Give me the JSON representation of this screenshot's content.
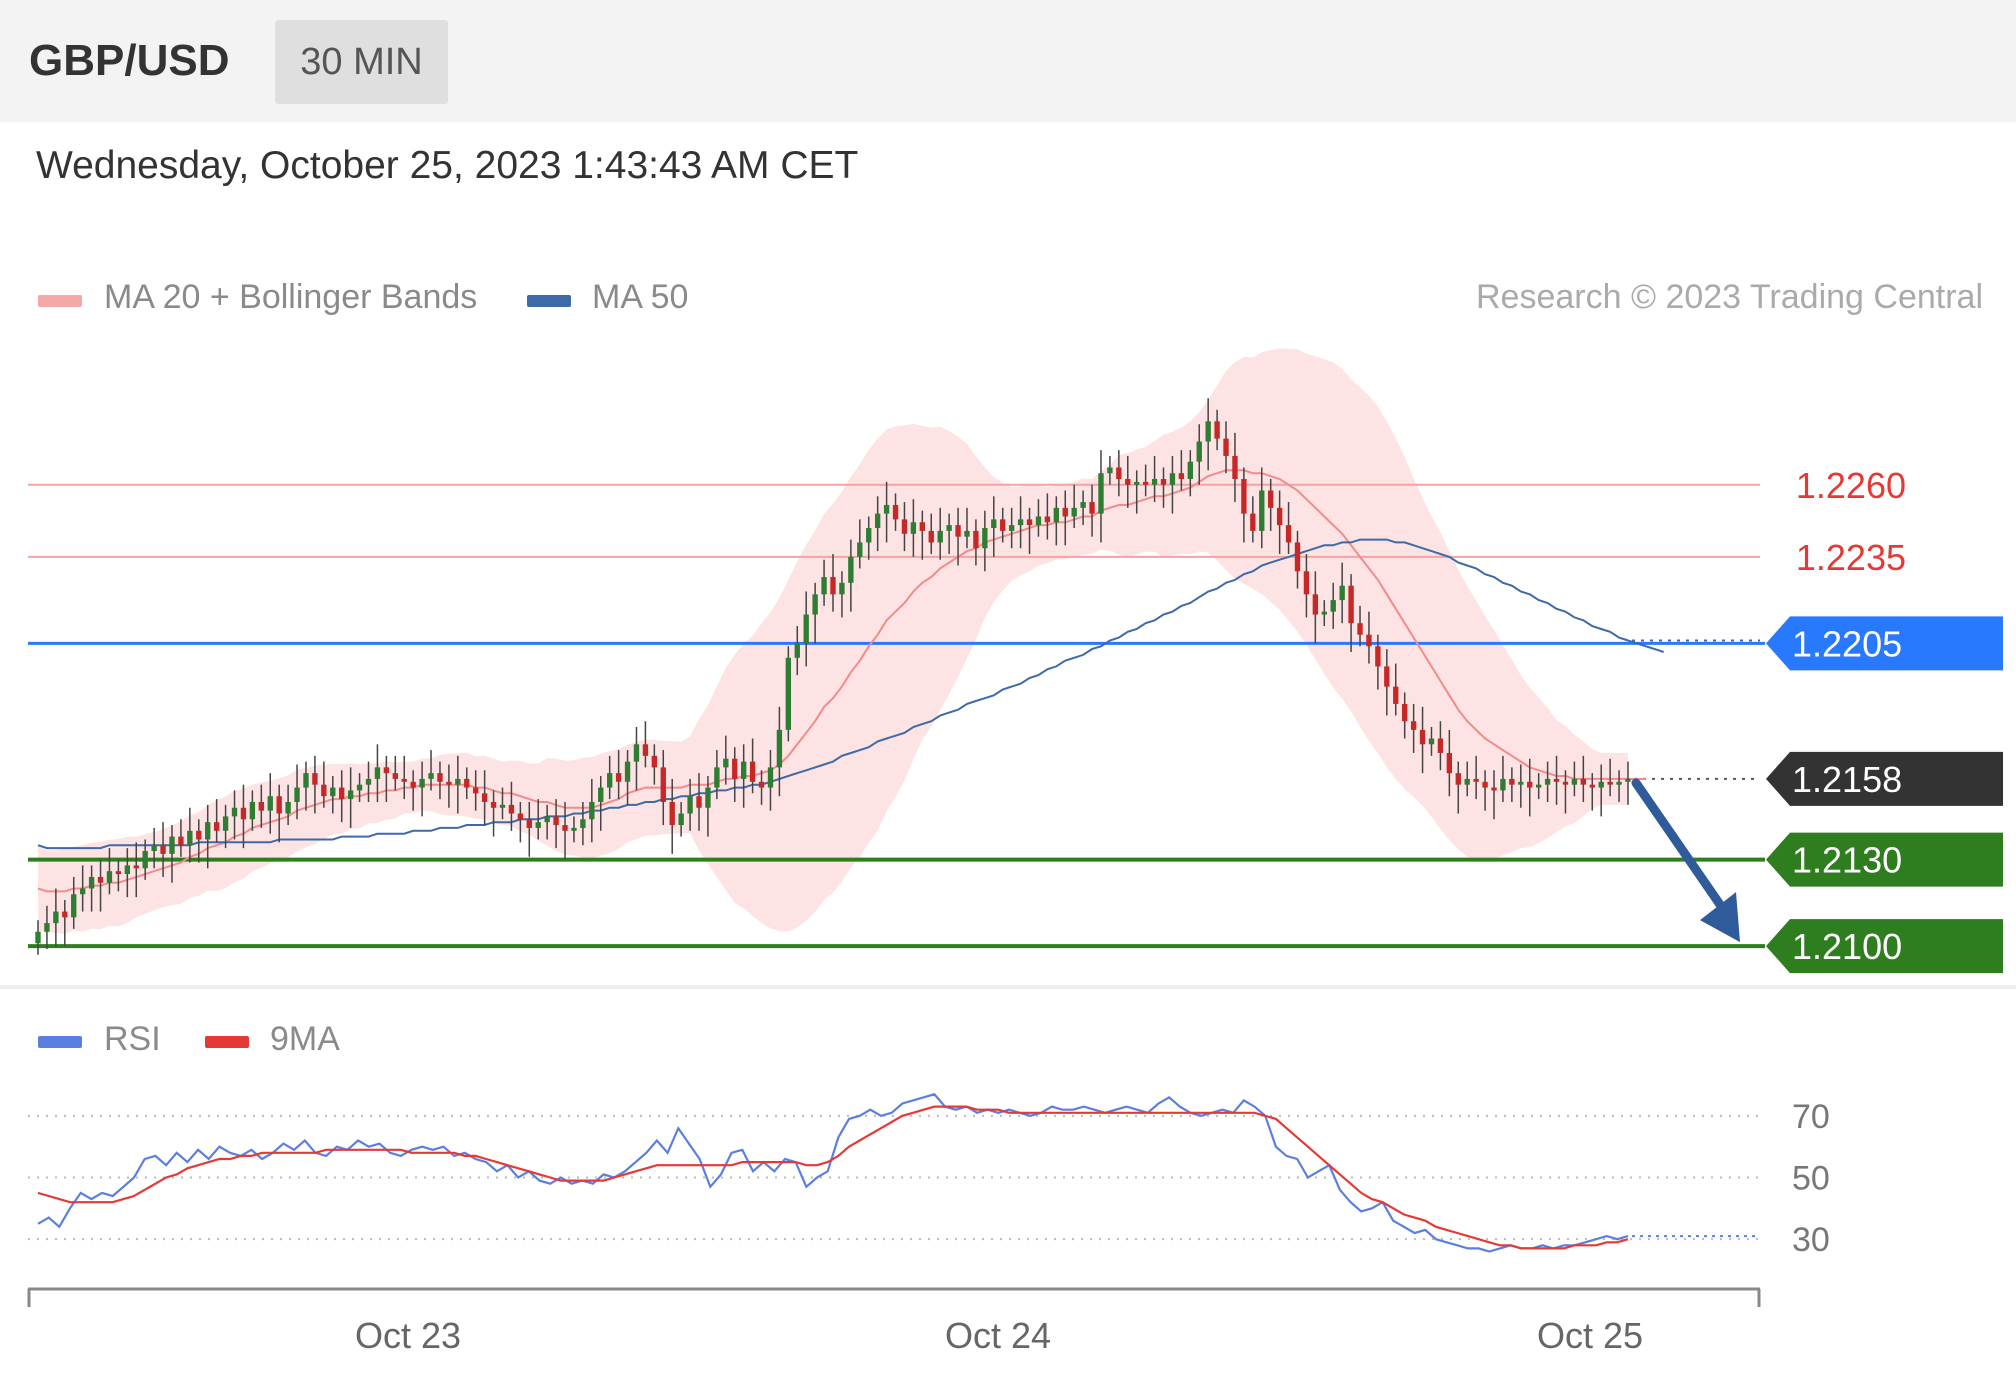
{
  "header": {
    "pair": "GBP/USD",
    "timeframe": "30 MIN",
    "datetime": "Wednesday, October 25, 2023 1:43:43 AM CET",
    "credit": "Research © 2023 Trading Central"
  },
  "colors": {
    "bollinger": "#f4a7a7",
    "band_fill": "#fde3e3",
    "ma20": "#f28b8b",
    "ma50": "#3f6aa8",
    "up_candle": "#2f7d32",
    "down_candle": "#c62828",
    "resistance_line": "#f3a3a3",
    "resistance_text": "#e53935",
    "pivot": "#2979ff",
    "support": "#2e7d1f",
    "current": "#333333",
    "arrow": "#2f5b9b",
    "rsi": "#5b7fe0",
    "rsi_ma": "#e53935"
  },
  "chart_data": [
    {
      "type": "candlestick",
      "legend": [
        {
          "name": "MA 20 + Bollinger Bands",
          "color": "#f4a7a7"
        },
        {
          "name": "MA 50",
          "color": "#3f6aa8"
        }
      ],
      "x_ticks": [
        "Oct 23",
        "Oct 24",
        "Oct 25"
      ],
      "ylim": [
        1.209,
        1.2305
      ],
      "levels": [
        {
          "value": 1.226,
          "label": "1.2260",
          "kind": "resistance"
        },
        {
          "value": 1.2235,
          "label": "1.2235",
          "kind": "resistance"
        },
        {
          "value": 1.2205,
          "label": "1.2205",
          "kind": "pivot"
        },
        {
          "value": 1.2158,
          "label": "1.2158",
          "kind": "current"
        },
        {
          "value": 1.213,
          "label": "1.2130",
          "kind": "support"
        },
        {
          "value": 1.21,
          "label": "1.2100",
          "kind": "support"
        }
      ],
      "close": [
        1.2105,
        1.2108,
        1.2112,
        1.211,
        1.2118,
        1.212,
        1.2124,
        1.2122,
        1.2126,
        1.2125,
        1.2128,
        1.2127,
        1.2133,
        1.2135,
        1.2132,
        1.2138,
        1.2135,
        1.214,
        1.2137,
        1.2143,
        1.214,
        1.2145,
        1.2148,
        1.2144,
        1.215,
        1.2147,
        1.2152,
        1.2146,
        1.215,
        1.2155,
        1.216,
        1.2156,
        1.2152,
        1.2155,
        1.2151,
        1.2154,
        1.2156,
        1.2158,
        1.2162,
        1.216,
        1.2158,
        1.2157,
        1.2155,
        1.2158,
        1.216,
        1.2157,
        1.2156,
        1.2158,
        1.2155,
        1.2153,
        1.215,
        1.2148,
        1.2149,
        1.2146,
        1.2144,
        1.2141,
        1.2143,
        1.2145,
        1.2142,
        1.214,
        1.2141,
        1.2144,
        1.215,
        1.2155,
        1.216,
        1.2157,
        1.2164,
        1.217,
        1.2166,
        1.2162,
        1.215,
        1.2142,
        1.2146,
        1.2152,
        1.2148,
        1.2155,
        1.2162,
        1.2165,
        1.2158,
        1.2164,
        1.2157,
        1.2155,
        1.2162,
        1.2175,
        1.22,
        1.2205,
        1.2215,
        1.2222,
        1.2228,
        1.2222,
        1.2226,
        1.2235,
        1.224,
        1.2245,
        1.225,
        1.2253,
        1.2248,
        1.2243,
        1.2247,
        1.2244,
        1.224,
        1.2244,
        1.2246,
        1.2242,
        1.2244,
        1.2238,
        1.2245,
        1.2248,
        1.2244,
        1.2246,
        1.2248,
        1.2246,
        1.2249,
        1.2247,
        1.2252,
        1.2249,
        1.2252,
        1.2254,
        1.225,
        1.2264,
        1.2266,
        1.2262,
        1.226,
        1.2261,
        1.226,
        1.2262,
        1.226,
        1.2264,
        1.2262,
        1.2268,
        1.2275,
        1.2282,
        1.2276,
        1.227,
        1.2262,
        1.225,
        1.2244,
        1.2258,
        1.2252,
        1.2246,
        1.224,
        1.223,
        1.2222,
        1.2215,
        1.2216,
        1.222,
        1.2225,
        1.2212,
        1.2208,
        1.2204,
        1.2197,
        1.219,
        1.2184,
        1.2178,
        1.2175,
        1.217,
        1.2172,
        1.2167,
        1.216,
        1.2156,
        1.2158,
        1.2157,
        1.2155,
        1.2154,
        1.2158,
        1.2156,
        1.2157,
        1.2155,
        1.2156,
        1.2158,
        1.2157,
        1.2156,
        1.2158,
        1.2156,
        1.2155,
        1.2157,
        1.2156,
        1.2157,
        1.2158
      ],
      "ma20": [
        1.212,
        1.2119,
        1.2119,
        1.2119,
        1.212,
        1.212,
        1.2121,
        1.2121,
        1.2122,
        1.2122,
        1.2123,
        1.2124,
        1.2125,
        1.2126,
        1.2127,
        1.2128,
        1.2129,
        1.2131,
        1.2132,
        1.2134,
        1.2135,
        1.2136,
        1.2138,
        1.2139,
        1.2141,
        1.2142,
        1.2143,
        1.2144,
        1.2145,
        1.2147,
        1.2148,
        1.2149,
        1.215,
        1.2151,
        1.2151,
        1.2152,
        1.2152,
        1.2153,
        1.2153,
        1.2154,
        1.2154,
        1.2155,
        1.2155,
        1.2156,
        1.2156,
        1.2156,
        1.2156,
        1.2156,
        1.2156,
        1.2155,
        1.2155,
        1.2154,
        1.2153,
        1.2153,
        1.2152,
        1.2151,
        1.215,
        1.215,
        1.2149,
        1.2148,
        1.2148,
        1.2148,
        1.2148,
        1.2149,
        1.215,
        1.2151,
        1.2153,
        1.2154,
        1.2155,
        1.2155,
        1.2155,
        1.2155,
        1.2155,
        1.2156,
        1.2156,
        1.2156,
        1.2157,
        1.2158,
        1.2158,
        1.2159,
        1.2159,
        1.216,
        1.2161,
        1.2163,
        1.2166,
        1.217,
        1.2174,
        1.2178,
        1.2183,
        1.2186,
        1.219,
        1.2195,
        1.2199,
        1.2204,
        1.2208,
        1.2213,
        1.2216,
        1.2219,
        1.2223,
        1.2226,
        1.2228,
        1.2231,
        1.2233,
        1.2235,
        1.2237,
        1.2238,
        1.224,
        1.2241,
        1.2242,
        1.2243,
        1.2244,
        1.2245,
        1.2246,
        1.2246,
        1.2247,
        1.2247,
        1.2248,
        1.2249,
        1.2249,
        1.2251,
        1.2252,
        1.2253,
        1.2253,
        1.2254,
        1.2255,
        1.2256,
        1.2256,
        1.2257,
        1.2258,
        1.2259,
        1.2261,
        1.2263,
        1.2264,
        1.2265,
        1.2265,
        1.2265,
        1.2264,
        1.2264,
        1.2263,
        1.2262,
        1.226,
        1.2258,
        1.2255,
        1.2252,
        1.2249,
        1.2246,
        1.2243,
        1.2239,
        1.2235,
        1.2231,
        1.2227,
        1.2222,
        1.2217,
        1.2212,
        1.2207,
        1.2202,
        1.2197,
        1.2192,
        1.2187,
        1.2182,
        1.2178,
        1.2175,
        1.2172,
        1.217,
        1.2168,
        1.2166,
        1.2164,
        1.2162,
        1.2161,
        1.216,
        1.2159,
        1.2159,
        1.2158,
        1.2158,
        1.2158,
        1.2158,
        1.2158,
        1.2158,
        1.2158,
        1.2158,
        1.2158
      ],
      "ma50": [
        1.2135,
        1.2134,
        1.2134,
        1.2134,
        1.2134,
        1.2134,
        1.2134,
        1.2134,
        1.2135,
        1.2135,
        1.2135,
        1.2135,
        1.2135,
        1.2135,
        1.2135,
        1.2135,
        1.2135,
        1.2135,
        1.2136,
        1.2136,
        1.2136,
        1.2136,
        1.2136,
        1.2136,
        1.2136,
        1.2136,
        1.2136,
        1.2137,
        1.2137,
        1.2137,
        1.2137,
        1.2137,
        1.2137,
        1.2137,
        1.2138,
        1.2138,
        1.2138,
        1.2138,
        1.2139,
        1.2139,
        1.2139,
        1.2139,
        1.214,
        1.214,
        1.214,
        1.2141,
        1.2141,
        1.2141,
        1.2142,
        1.2142,
        1.2142,
        1.2143,
        1.2143,
        1.2143,
        1.2144,
        1.2144,
        1.2144,
        1.2145,
        1.2145,
        1.2145,
        1.2146,
        1.2146,
        1.2147,
        1.2147,
        1.2148,
        1.2148,
        1.2149,
        1.2149,
        1.215,
        1.215,
        1.2151,
        1.2151,
        1.2152,
        1.2152,
        1.2153,
        1.2153,
        1.2154,
        1.2154,
        1.2155,
        1.2155,
        1.2156,
        1.2156,
        1.2157,
        1.2158,
        1.2159,
        1.216,
        1.2161,
        1.2162,
        1.2163,
        1.2164,
        1.2166,
        1.2167,
        1.2168,
        1.2169,
        1.2171,
        1.2172,
        1.2173,
        1.2174,
        1.2176,
        1.2177,
        1.2178,
        1.218,
        1.2181,
        1.2182,
        1.2184,
        1.2185,
        1.2186,
        1.2187,
        1.2189,
        1.219,
        1.2191,
        1.2193,
        1.2194,
        1.2196,
        1.2197,
        1.2199,
        1.22,
        1.2201,
        1.2203,
        1.2204,
        1.2206,
        1.2207,
        1.2209,
        1.221,
        1.2212,
        1.2213,
        1.2215,
        1.2216,
        1.2218,
        1.2219,
        1.2221,
        1.2223,
        1.2224,
        1.2226,
        1.2227,
        1.2229,
        1.223,
        1.2232,
        1.2233,
        1.2234,
        1.2235,
        1.2236,
        1.2237,
        1.2238,
        1.2239,
        1.2239,
        1.224,
        1.224,
        1.2241,
        1.2241,
        1.2241,
        1.2241,
        1.224,
        1.224,
        1.2239,
        1.2238,
        1.2237,
        1.2236,
        1.2235,
        1.2233,
        1.2232,
        1.2231,
        1.2229,
        1.2228,
        1.2226,
        1.2225,
        1.2223,
        1.2222,
        1.222,
        1.2219,
        1.2217,
        1.2216,
        1.2214,
        1.2213,
        1.2211,
        1.221,
        1.2209,
        1.2207,
        1.2206,
        1.2205,
        1.2204,
        1.2203,
        1.2202
      ]
    },
    {
      "type": "line",
      "legend": [
        {
          "name": "RSI",
          "color": "#5b7fe0"
        },
        {
          "name": "9MA",
          "color": "#e53935"
        }
      ],
      "ylim": [
        20,
        80
      ],
      "y_ticks": [
        70,
        50,
        30
      ],
      "series": [
        {
          "name": "RSI",
          "values": [
            35,
            37,
            34,
            40,
            45,
            43,
            45,
            44,
            47,
            50,
            56,
            57,
            54,
            58,
            55,
            59,
            56,
            60,
            58,
            57,
            59,
            56,
            58,
            61,
            59,
            62,
            58,
            57,
            60,
            59,
            62,
            60,
            61,
            58,
            57,
            59,
            60,
            59,
            60,
            57,
            58,
            56,
            55,
            52,
            54,
            50,
            52,
            49,
            48,
            50,
            48,
            49,
            48,
            51,
            50,
            52,
            55,
            58,
            62,
            58,
            66,
            61,
            56,
            47,
            51,
            58,
            59,
            52,
            55,
            52,
            56,
            55,
            47,
            50,
            52,
            63,
            69,
            70,
            72,
            70,
            71,
            74,
            75,
            76,
            77,
            73,
            72,
            73,
            71,
            72,
            71,
            72,
            71,
            70,
            71,
            73,
            72,
            72,
            73,
            72,
            71,
            72,
            73,
            72,
            71,
            74,
            76,
            73,
            71,
            70,
            71,
            72,
            71,
            75,
            73,
            70,
            60,
            57,
            56,
            50,
            52,
            54,
            46,
            42,
            39,
            40,
            42,
            36,
            34,
            32,
            33,
            30,
            29,
            28,
            27,
            27,
            26,
            27,
            28,
            27,
            27,
            28,
            27,
            28,
            28,
            29,
            30,
            31,
            30,
            31
          ]
        },
        {
          "name": "9MA",
          "values": [
            45,
            44,
            43,
            42,
            42,
            42,
            42,
            42,
            43,
            44,
            46,
            48,
            50,
            51,
            53,
            54,
            55,
            56,
            56,
            57,
            57,
            58,
            58,
            58,
            58,
            58,
            58,
            59,
            59,
            59,
            59,
            59,
            59,
            59,
            59,
            58,
            58,
            58,
            58,
            58,
            57,
            57,
            56,
            55,
            54,
            53,
            52,
            51,
            50,
            49,
            49,
            49,
            49,
            49,
            50,
            51,
            52,
            53,
            54,
            54,
            54,
            54,
            54,
            54,
            54,
            54,
            55,
            55,
            55,
            55,
            55,
            55,
            54,
            54,
            55,
            57,
            60,
            62,
            64,
            66,
            68,
            70,
            71,
            72,
            73,
            73,
            73,
            73,
            72,
            72,
            72,
            71,
            71,
            71,
            71,
            71,
            71,
            71,
            71,
            71,
            71,
            71,
            71,
            71,
            71,
            71,
            71,
            71,
            71,
            71,
            71,
            71,
            71,
            71,
            71,
            70,
            69,
            66,
            63,
            60,
            57,
            54,
            51,
            48,
            45,
            43,
            42,
            40,
            38,
            37,
            36,
            34,
            33,
            32,
            31,
            30,
            29,
            28,
            28,
            27,
            27,
            27,
            27,
            27,
            28,
            28,
            28,
            29,
            29,
            30
          ]
        }
      ]
    }
  ]
}
